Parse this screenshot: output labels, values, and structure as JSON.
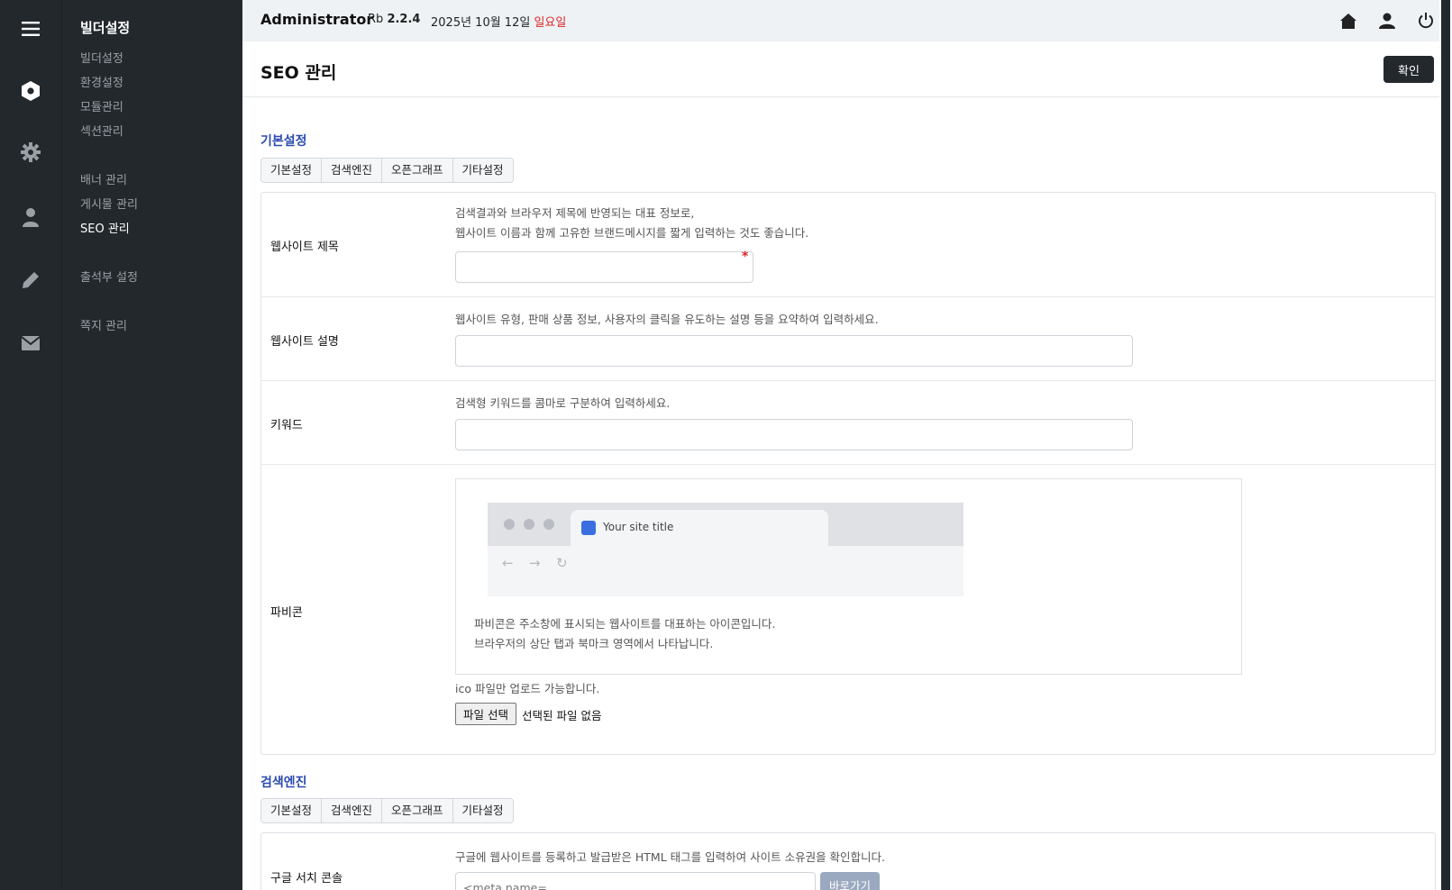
{
  "rail": {
    "icons": [
      "menu-icon",
      "hexagon-icon",
      "gear-icon",
      "user-icon",
      "pencil-icon",
      "mail-icon"
    ]
  },
  "submenu": {
    "title": "빌더설정",
    "items": [
      {
        "label": "빌더설정"
      },
      {
        "label": "환경설정"
      },
      {
        "label": "모듈관리"
      },
      {
        "label": "섹션관리"
      },
      {
        "label": "배너 관리"
      },
      {
        "label": "게시물 관리"
      },
      {
        "label": "SEO 관리"
      },
      {
        "label": "출석부 설정"
      },
      {
        "label": "쪽지 관리"
      }
    ]
  },
  "header": {
    "admin": "Administrator",
    "version_prefix": "Rb",
    "version": "2.2.4",
    "date": "2025년 10월 12일",
    "weekday": "일요일"
  },
  "page": {
    "title": "SEO 관리",
    "confirm_label": "확인"
  },
  "tabs": [
    "기본설정",
    "검색엔진",
    "오픈그래프",
    "기타설정"
  ],
  "basic": {
    "section_title": "기본설정",
    "site_title": {
      "label": "웹사이트 제목",
      "help_1": "검색결과와 브라우저 제목에 반영되는 대표 정보로,",
      "help_2": "웹사이트 이름과 함께 고유한 브랜드메시지를 짧게 입력하는 것도 좋습니다.",
      "required_mark": "*"
    },
    "site_desc": {
      "label": "웹사이트 설명",
      "help": "웹사이트 유형, 판매 상품 정보, 사용자의 클릭을 유도하는 설명 등을 요약하여 입력하세요."
    },
    "keywords": {
      "label": "키워드",
      "help": "검색형 키워드를 콤마로 구분하여 입력하세요."
    },
    "favicon": {
      "label": "파비콘",
      "preview_tab_title": "Your site title",
      "desc_1": "파비콘은 주소창에 표시되는 웹사이트를 대표하는 아이콘입니다.",
      "desc_2": "브라우저의 상단 탭과 북마크 영역에서 나타납니다.",
      "upload_help": "ico 파일만 업로드 가능합니다.",
      "file_button": "파일 선택",
      "file_status": "선택된 파일 없음"
    }
  },
  "search": {
    "section_title": "검색엔진",
    "google": {
      "label": "구글 서치 콘솔",
      "help": "구글에 웹사이트를 등록하고 발급받은 HTML 태그를 입력하여 사이트 소유권을 확인합니다.",
      "placeholder": "<meta name=",
      "go_label": "바로가기"
    }
  }
}
